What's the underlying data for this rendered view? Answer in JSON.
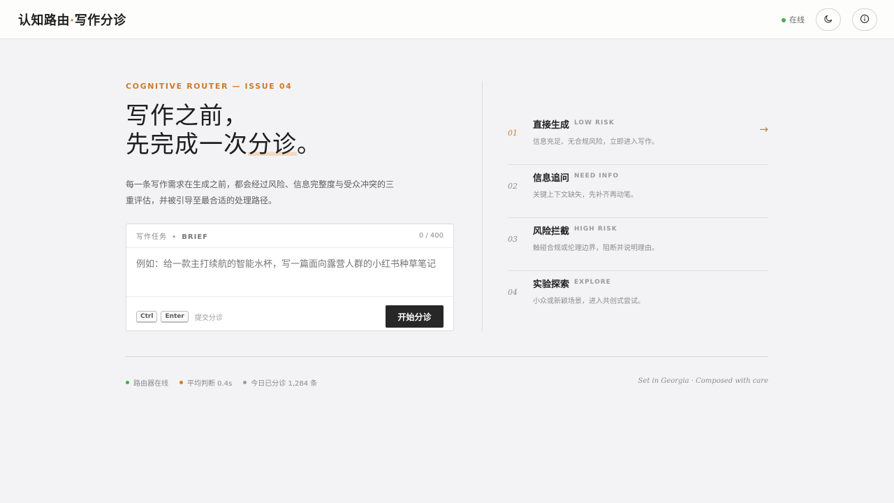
{
  "header": {
    "brand_main": "认知路由",
    "brand_dot": "·",
    "brand_sub": "写作分诊",
    "status_label": "在线",
    "status_color": "#3fae48",
    "theme_icon": "moon-icon",
    "info_icon": "info-icon"
  },
  "hero": {
    "eyebrow": "COGNITIVE ROUTER — ISSUE 04",
    "headline_line1": "写作之前，",
    "headline_line2_pre": "先完成一次",
    "headline_line2_highlight": "分诊",
    "headline_line2_post": "。",
    "description": "每一条写作需求在生成之前，都会经过风险、信息完整度与受众冲突的三重评估，并被引导至最合适的处理路径。",
    "accent_color": "#d07a26"
  },
  "brief": {
    "label": "写作任务",
    "label_sep": "•",
    "label_en": "BRIEF",
    "counter": "0 / 400",
    "placeholder": "例如：给一款主打续航的智能水杯，写一篇面向露营人群的小红书种草笔记",
    "key1": "Ctrl",
    "key2": "Enter",
    "hint": "提交分诊",
    "submit_label": "开始分诊"
  },
  "routes": [
    {
      "num": "01",
      "name": "直接生成",
      "tag": "LOW RISK",
      "desc": "信息充足、无合规风险，立即进入写作。",
      "active": true,
      "arrow": "→"
    },
    {
      "num": "02",
      "name": "信息追问",
      "tag": "NEED INFO",
      "desc": "关键上下文缺失，先补齐再动笔。"
    },
    {
      "num": "03",
      "name": "风险拦截",
      "tag": "HIGH RISK",
      "desc": "触碰合规或伦理边界，阻断并说明理由。"
    },
    {
      "num": "04",
      "name": "实验探索",
      "tag": "EXPLORE",
      "desc": "小众或新颖场景，进入共创式尝试。"
    }
  ],
  "footer": {
    "stats": [
      {
        "label": "路由器在线",
        "color": "#3fae48"
      },
      {
        "label": "平均判断 0.4s",
        "color": "#d07a26"
      },
      {
        "label": "今日已分诊 1,284 条",
        "color": "#9a9a9a"
      }
    ],
    "credit": "Set in Georgia · Composed with care"
  }
}
